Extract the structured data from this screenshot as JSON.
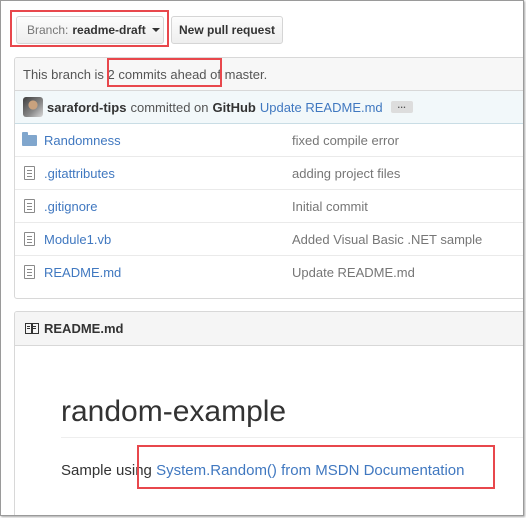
{
  "toolbar": {
    "branch_prefix": "Branch:",
    "branch_name": "readme-draft",
    "new_pull_request": "New pull request"
  },
  "branch_status": {
    "before": "This branch is",
    "commits_ahead": "2 commits ahead",
    "after": "of master."
  },
  "latest_commit": {
    "author": "saraford-tips",
    "committed_on": "committed on",
    "platform": "GitHub",
    "message": "Update README.md",
    "ellipsis": "…"
  },
  "files": [
    {
      "name": "Randomness",
      "type": "folder",
      "message": "fixed compile error",
      "icon": "folder-icon"
    },
    {
      "name": ".gitattributes",
      "type": "file",
      "message": "adding project files",
      "icon": "file-icon"
    },
    {
      "name": ".gitignore",
      "type": "file",
      "message": "Initial commit",
      "icon": "file-icon"
    },
    {
      "name": "Module1.vb",
      "type": "file",
      "message": "Added Visual Basic .NET sample",
      "icon": "file-icon"
    },
    {
      "name": "README.md",
      "type": "file",
      "message": "Update README.md",
      "icon": "file-icon"
    }
  ],
  "readme": {
    "header": "README.md",
    "title": "random-example",
    "body_prefix": "Sample using",
    "link_text": "System.Random() from MSDN Documentation"
  },
  "colors": {
    "highlight": "#e8474c",
    "link": "#4078c0",
    "folder": "#80a6cd"
  }
}
